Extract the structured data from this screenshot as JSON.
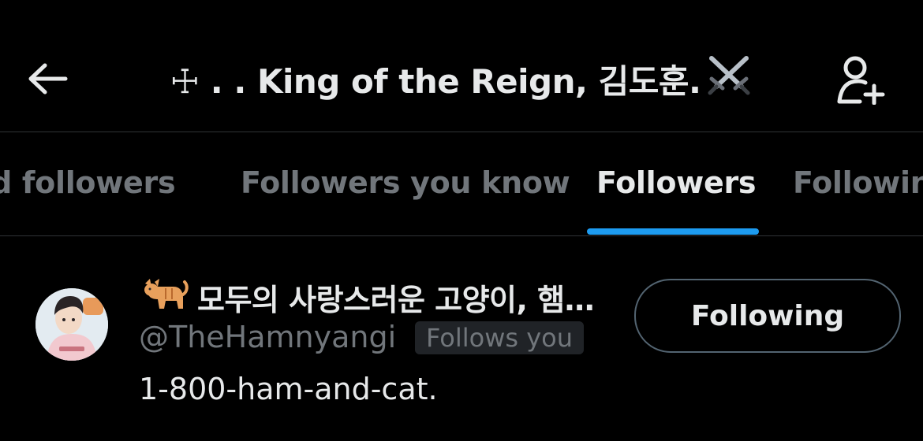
{
  "header": {
    "title": "☩ . . King of the Reign, 김도훈.",
    "back_icon": "arrow-left-icon",
    "title_icon": "crossed-swords-icon",
    "add_user_icon": "add-user-icon"
  },
  "tabs": [
    {
      "label": "Verified followers",
      "active": false
    },
    {
      "label": "Followers you know",
      "active": false
    },
    {
      "label": "Followers",
      "active": true
    },
    {
      "label": "Following",
      "active": false
    }
  ],
  "user": {
    "display_name": "모두의 사랑스러운 고양이, 햄…",
    "name_icon": "cat-emoji-icon",
    "handle": "@TheHamnyangi",
    "follows_you": "Follows you",
    "bio": "1-800-ham-and-cat.",
    "button_label": "Following"
  },
  "colors": {
    "background": "#000000",
    "text_primary": "#e7e9ea",
    "text_secondary": "#71767b",
    "accent": "#1d9bf0",
    "divider": "#2f3336"
  }
}
